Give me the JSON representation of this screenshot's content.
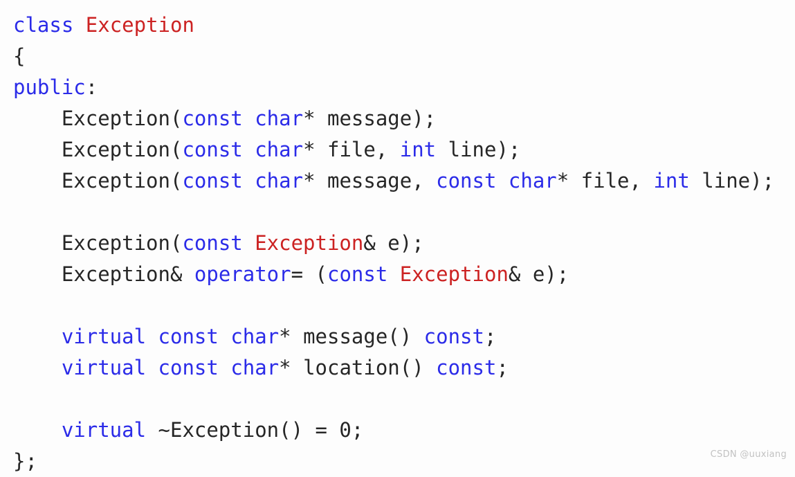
{
  "document": {
    "kind": "code-snippet",
    "language": "C++",
    "background_color": "#fdfdfd",
    "colors": {
      "keyword": "#2b2be8",
      "type": "#cc2222",
      "plain": "#262626",
      "watermark": "#c2c2c2"
    },
    "full_text": "class Exception\n{\npublic:\n    Exception(const char* message);\n    Exception(const char* file, int line);\n    Exception(const char* message, const char* file, int line);\n\n    Exception(const Exception& e);\n    Exception& operator= (const Exception& e);\n\n    virtual const char* message() const;\n    virtual const char* location() const;\n\n    virtual ~Exception() = 0;\n};"
  },
  "lines": [
    {
      "index": 1,
      "text": "class Exception",
      "tokens": [
        {
          "t": "class",
          "c": "kw"
        },
        {
          "t": " ",
          "c": "pl"
        },
        {
          "t": "Exception",
          "c": "ty"
        }
      ]
    },
    {
      "index": 2,
      "text": "{",
      "tokens": [
        {
          "t": "{",
          "c": "pl"
        }
      ]
    },
    {
      "index": 3,
      "text": "public:",
      "tokens": [
        {
          "t": "public",
          "c": "kw"
        },
        {
          "t": ":",
          "c": "pl"
        }
      ]
    },
    {
      "index": 4,
      "text": "    Exception(const char* message);",
      "tokens": [
        {
          "t": "    Exception(",
          "c": "pl"
        },
        {
          "t": "const",
          "c": "kw"
        },
        {
          "t": " ",
          "c": "pl"
        },
        {
          "t": "char",
          "c": "kw"
        },
        {
          "t": "* message);",
          "c": "pl"
        }
      ]
    },
    {
      "index": 5,
      "text": "    Exception(const char* file, int line);",
      "tokens": [
        {
          "t": "    Exception(",
          "c": "pl"
        },
        {
          "t": "const",
          "c": "kw"
        },
        {
          "t": " ",
          "c": "pl"
        },
        {
          "t": "char",
          "c": "kw"
        },
        {
          "t": "* file, ",
          "c": "pl"
        },
        {
          "t": "int",
          "c": "kw"
        },
        {
          "t": " line);",
          "c": "pl"
        }
      ]
    },
    {
      "index": 6,
      "text": "    Exception(const char* message, const char* file, int line);",
      "tokens": [
        {
          "t": "    Exception(",
          "c": "pl"
        },
        {
          "t": "const",
          "c": "kw"
        },
        {
          "t": " ",
          "c": "pl"
        },
        {
          "t": "char",
          "c": "kw"
        },
        {
          "t": "* message, ",
          "c": "pl"
        },
        {
          "t": "const",
          "c": "kw"
        },
        {
          "t": " ",
          "c": "pl"
        },
        {
          "t": "char",
          "c": "kw"
        },
        {
          "t": "* file, ",
          "c": "pl"
        },
        {
          "t": "int",
          "c": "kw"
        },
        {
          "t": " line);",
          "c": "pl"
        }
      ]
    },
    {
      "index": 7,
      "text": "",
      "tokens": []
    },
    {
      "index": 8,
      "text": "    Exception(const Exception& e);",
      "tokens": [
        {
          "t": "    Exception(",
          "c": "pl"
        },
        {
          "t": "const",
          "c": "kw"
        },
        {
          "t": " ",
          "c": "pl"
        },
        {
          "t": "Exception",
          "c": "ty"
        },
        {
          "t": "& e);",
          "c": "pl"
        }
      ]
    },
    {
      "index": 9,
      "text": "    Exception& operator= (const Exception& e);",
      "tokens": [
        {
          "t": "    Exception& ",
          "c": "pl"
        },
        {
          "t": "operator",
          "c": "kw"
        },
        {
          "t": "= (",
          "c": "pl"
        },
        {
          "t": "const",
          "c": "kw"
        },
        {
          "t": " ",
          "c": "pl"
        },
        {
          "t": "Exception",
          "c": "ty"
        },
        {
          "t": "& e);",
          "c": "pl"
        }
      ]
    },
    {
      "index": 10,
      "text": "",
      "tokens": []
    },
    {
      "index": 11,
      "text": "    virtual const char* message() const;",
      "tokens": [
        {
          "t": "    ",
          "c": "pl"
        },
        {
          "t": "virtual",
          "c": "kw"
        },
        {
          "t": " ",
          "c": "pl"
        },
        {
          "t": "const",
          "c": "kw"
        },
        {
          "t": " ",
          "c": "pl"
        },
        {
          "t": "char",
          "c": "kw"
        },
        {
          "t": "* message() ",
          "c": "pl"
        },
        {
          "t": "const",
          "c": "kw"
        },
        {
          "t": ";",
          "c": "pl"
        }
      ]
    },
    {
      "index": 12,
      "text": "    virtual const char* location() const;",
      "tokens": [
        {
          "t": "    ",
          "c": "pl"
        },
        {
          "t": "virtual",
          "c": "kw"
        },
        {
          "t": " ",
          "c": "pl"
        },
        {
          "t": "const",
          "c": "kw"
        },
        {
          "t": " ",
          "c": "pl"
        },
        {
          "t": "char",
          "c": "kw"
        },
        {
          "t": "* location() ",
          "c": "pl"
        },
        {
          "t": "const",
          "c": "kw"
        },
        {
          "t": ";",
          "c": "pl"
        }
      ]
    },
    {
      "index": 13,
      "text": "",
      "tokens": []
    },
    {
      "index": 14,
      "text": "    virtual ~Exception() = 0;",
      "tokens": [
        {
          "t": "    ",
          "c": "pl"
        },
        {
          "t": "virtual",
          "c": "kw"
        },
        {
          "t": " ~Exception() = 0;",
          "c": "pl"
        }
      ]
    },
    {
      "index": 15,
      "text": "};",
      "tokens": [
        {
          "t": "};",
          "c": "pl"
        }
      ]
    }
  ],
  "watermark": {
    "label": "CSDN @uuxiang"
  }
}
